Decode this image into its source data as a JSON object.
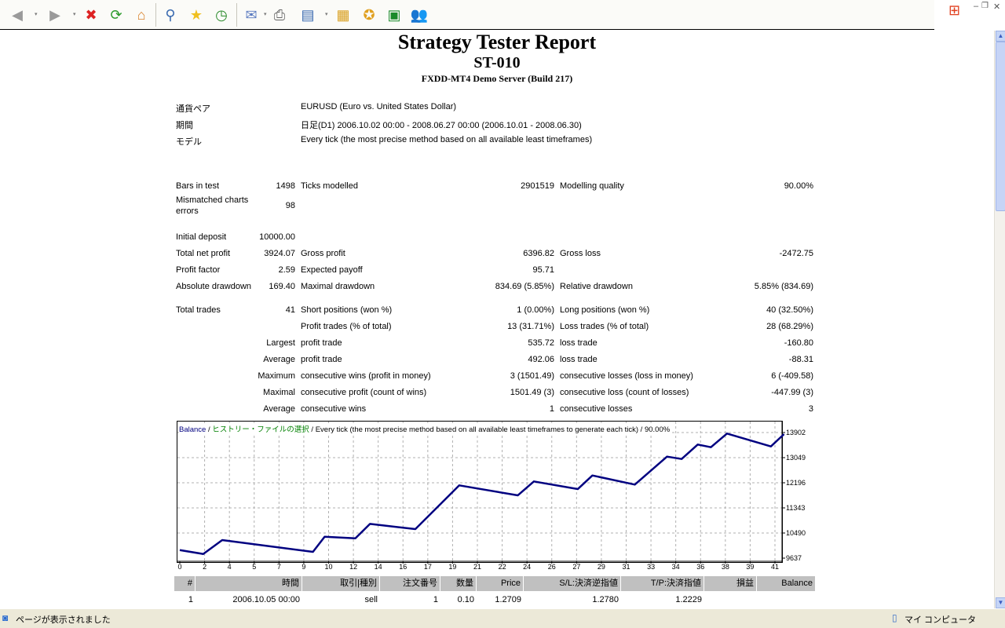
{
  "toolbar": {
    "icons": [
      "back-icon",
      "forward-icon",
      "stop-icon",
      "refresh-icon",
      "home-icon",
      "search-icon",
      "favorites-icon",
      "history-icon",
      "mail-icon",
      "print-icon",
      "edit-icon",
      "research-icon",
      "messenger-star-icon",
      "green-app-icon",
      "msn-messenger-icon"
    ]
  },
  "report": {
    "title": "Strategy Tester Report",
    "subtitle": "ST-010",
    "server": "FXDD-MT4 Demo Server (Build 217)",
    "info": [
      {
        "label": "通貨ペア",
        "value": "EURUSD (Euro vs. United States Dollar)"
      },
      {
        "label": "期間",
        "value": "日足(D1) 2006.10.02 00:00 - 2008.06.27 00:00 (2006.10.01 - 2008.06.30)"
      },
      {
        "label": "モデル",
        "value": "Every tick (the most precise method based on all available least timeframes)"
      }
    ],
    "stats": [
      [
        "Bars in test",
        "1498",
        "Ticks modelled",
        "2901519",
        "Modelling quality",
        "90.00%"
      ],
      [
        "Mismatched charts errors",
        "98",
        "",
        "",
        "",
        ""
      ],
      [
        "Initial deposit",
        "10000.00",
        "",
        "",
        "",
        ""
      ],
      [
        "Total net profit",
        "3924.07",
        "Gross profit",
        "6396.82",
        "Gross loss",
        "-2472.75"
      ],
      [
        "Profit factor",
        "2.59",
        "Expected payoff",
        "95.71",
        "",
        ""
      ],
      [
        "Absolute drawdown",
        "169.40",
        "Maximal drawdown",
        "834.69 (5.85%)",
        "Relative drawdown",
        "5.85% (834.69)"
      ],
      [
        "Total trades",
        "41",
        "Short positions (won %)",
        "1 (0.00%)",
        "Long positions (won %)",
        "40 (32.50%)"
      ],
      [
        "",
        "",
        "Profit trades (% of total)",
        "13 (31.71%)",
        "Loss trades (% of total)",
        "28 (68.29%)"
      ],
      [
        "",
        "Largest",
        "profit trade",
        "535.72",
        "loss trade",
        "-160.80"
      ],
      [
        "",
        "Average",
        "profit trade",
        "492.06",
        "loss trade",
        "-88.31"
      ],
      [
        "",
        "Maximum",
        "consecutive wins (profit in money)",
        "3 (1501.49)",
        "consecutive losses (loss in money)",
        "6 (-409.58)"
      ],
      [
        "",
        "Maximal",
        "consecutive profit (count of wins)",
        "1501.49 (3)",
        "consecutive loss (count of losses)",
        "-447.99 (3)"
      ],
      [
        "",
        "Average",
        "consecutive wins",
        "1",
        "consecutive losses",
        "3"
      ]
    ]
  },
  "chart_data": {
    "type": "line",
    "legend": {
      "series": "Balance",
      "sep1": " / ",
      "history": "ヒストリー・ファイルの選択",
      "sep2": " / ",
      "model": "Every tick (the most precise method based on all available least timeframes to generate each tick) / 90.00%"
    },
    "x_tick_labels": [
      "0",
      "2",
      "4",
      "5",
      "7",
      "9",
      "10",
      "12",
      "14",
      "16",
      "17",
      "19",
      "21",
      "22",
      "24",
      "26",
      "27",
      "29",
      "31",
      "33",
      "34",
      "36",
      "38",
      "39",
      "41"
    ],
    "y_tick_labels": [
      "13902",
      "13049",
      "12196",
      "11343",
      "10490",
      "9637"
    ],
    "ylim": [
      9637,
      13902
    ],
    "xlim": [
      0,
      41
    ],
    "grid": true,
    "line_color": "#000080",
    "legend_history_color": "#008000",
    "x": [
      0,
      1.6,
      2.9,
      9.1,
      9.9,
      12.0,
      13.0,
      16.1,
      19.1,
      23.1,
      24.2,
      27.2,
      28.2,
      31.1,
      33.3,
      34.3,
      35.4,
      36.3,
      37.4,
      40.4,
      41.3
    ],
    "balance": [
      9910,
      9778,
      10250,
      9850,
      10364,
      10311,
      10801,
      10623,
      12108,
      11769,
      12241,
      11982,
      12444,
      12134,
      13084,
      13004,
      13494,
      13404,
      13867,
      13430,
      13849
    ]
  },
  "trades": {
    "headers": [
      "#",
      "時間",
      "取引|種別",
      "注文番号",
      "数量",
      "Price",
      "S/L:決済逆指値",
      "T/P:決済指値",
      "損益",
      "Balance"
    ],
    "rows": [
      [
        "1",
        "2006.10.05 00:00",
        "sell",
        "1",
        "0.10",
        "1.2709",
        "1.2780",
        "1.2229",
        "",
        ""
      ]
    ]
  },
  "statusbar": {
    "message": "ページが表示されました",
    "zone": "マイ コンピュータ"
  }
}
